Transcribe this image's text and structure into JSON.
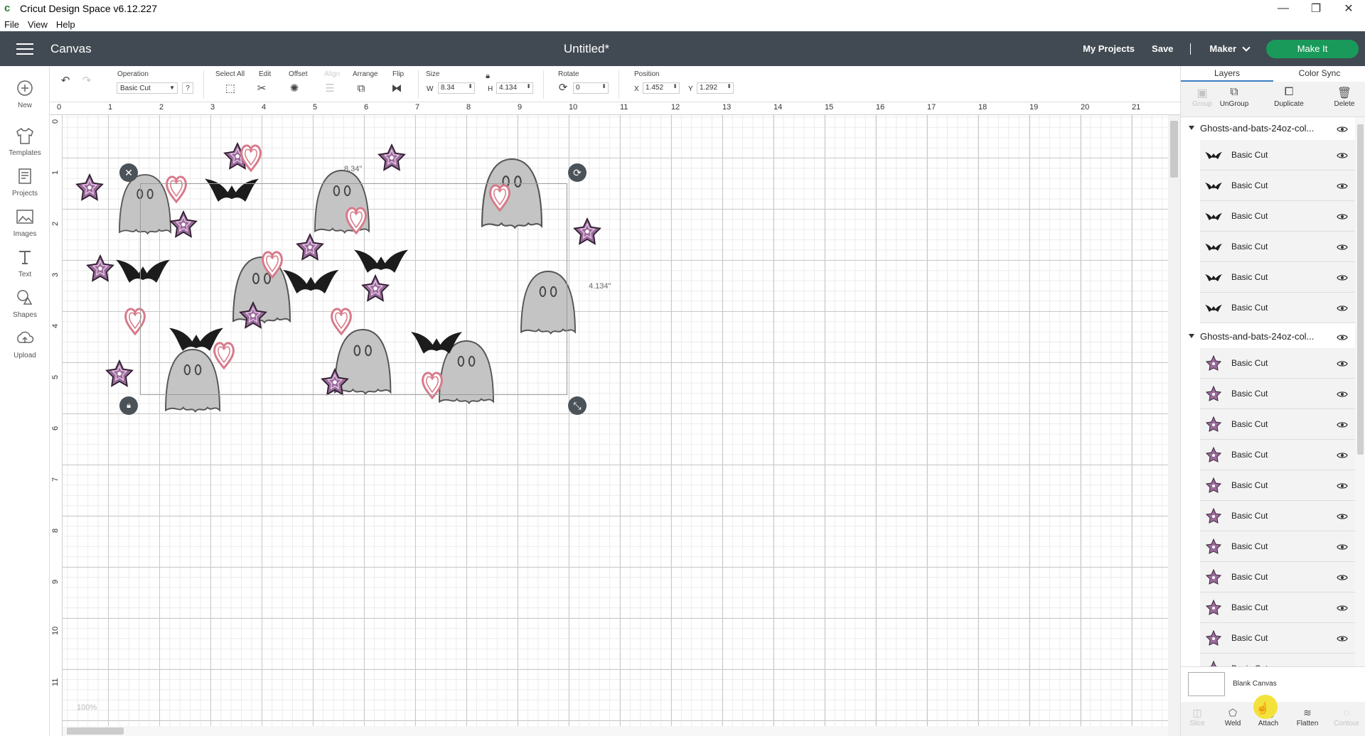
{
  "window": {
    "title": "Cricut Design Space  v6.12.227",
    "controls": [
      "—",
      "❐",
      "✕"
    ]
  },
  "menu": [
    "File",
    "View",
    "Help"
  ],
  "header": {
    "section": "Canvas",
    "doc_title": "Untitled*",
    "my_projects": "My Projects",
    "save": "Save",
    "separator": "|",
    "machine": "Maker",
    "make_it": "Make It",
    "bg_color": "#414a52",
    "make_it_color": "#1a9a5a"
  },
  "sidebar": [
    {
      "label": "New",
      "icon": "plus-circle-icon"
    },
    {
      "label": "Templates",
      "icon": "shirt-icon"
    },
    {
      "label": "Projects",
      "icon": "projects-icon"
    },
    {
      "label": "Images",
      "icon": "image-icon"
    },
    {
      "label": "Text",
      "icon": "text-icon"
    },
    {
      "label": "Shapes",
      "icon": "shapes-icon"
    },
    {
      "label": "Upload",
      "icon": "upload-icon"
    }
  ],
  "toolbar": {
    "operation_label": "Operation",
    "operation_value": "Basic Cut",
    "help": "?",
    "select_all": "Select All",
    "edit": "Edit",
    "offset": "Offset",
    "align": "Align",
    "arrange": "Arrange",
    "flip": "Flip",
    "size_label": "Size",
    "w_label": "W",
    "w_value": "8.34",
    "h_label": "H",
    "h_value": "4.134",
    "rotate_label": "Rotate",
    "rotate_value": "0",
    "position_label": "Position",
    "x_label": "X",
    "x_value": "1.452",
    "y_label": "Y",
    "y_value": "1.292"
  },
  "ruler": {
    "top": [
      "0",
      "1",
      "2",
      "3",
      "4",
      "5",
      "6",
      "7",
      "8",
      "9",
      "10",
      "11",
      "12",
      "13",
      "14",
      "15",
      "16",
      "17",
      "18",
      "19",
      "20",
      "21"
    ],
    "left": [
      "0",
      "1",
      "2",
      "3",
      "4",
      "5",
      "6",
      "7",
      "8",
      "9",
      "10",
      "11"
    ]
  },
  "canvas": {
    "width_label": "8.34\"",
    "height_label": "4.134\"",
    "zoom": "100%"
  },
  "panel": {
    "tabs": [
      "Layers",
      "Color Sync"
    ],
    "actions": [
      {
        "label": "Group",
        "enabled": false
      },
      {
        "label": "UnGroup",
        "enabled": true
      },
      {
        "label": "Duplicate",
        "enabled": true
      },
      {
        "label": "Delete",
        "enabled": true
      }
    ],
    "groups": [
      {
        "name": "Ghosts-and-bats-24oz-col...",
        "layers": [
          "Basic Cut",
          "Basic Cut",
          "Basic Cut",
          "Basic Cut",
          "Basic Cut",
          "Basic Cut"
        ]
      },
      {
        "name": "Ghosts-and-bats-24oz-col...",
        "layers": [
          "Basic Cut",
          "Basic Cut",
          "Basic Cut",
          "Basic Cut",
          "Basic Cut",
          "Basic Cut",
          "Basic Cut",
          "Basic Cut",
          "Basic Cut",
          "Basic Cut",
          "Basic Cut"
        ]
      }
    ],
    "blank_canvas": "Blank Canvas",
    "footer": [
      {
        "label": "Slice",
        "enabled": false
      },
      {
        "label": "Weld",
        "enabled": true
      },
      {
        "label": "Attach",
        "enabled": true
      },
      {
        "label": "Flatten",
        "enabled": true
      },
      {
        "label": "Contour",
        "enabled": false
      }
    ]
  },
  "colors": {
    "ghost": "#c4c4c4",
    "bat": "#1c1c1c",
    "star": "#9a6b9a",
    "heart": "#d77a8a"
  }
}
